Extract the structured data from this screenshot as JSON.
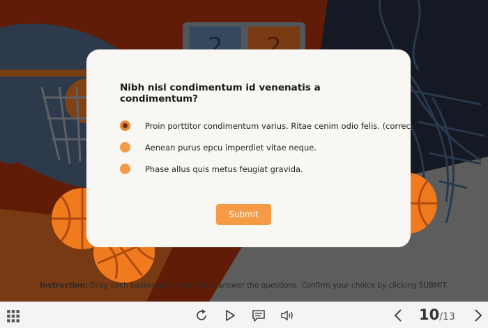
{
  "question": {
    "text": "Nibh nisl condimentum id venenatis a condimentum?",
    "options": [
      {
        "label": "Proin porttitor condimentum varius. Ritae cenim odio felis. (correct)",
        "selected": true
      },
      {
        "label": "Aenean purus epcu imperdiet vitae neque.",
        "selected": false
      },
      {
        "label": "Phase allus quis metus feugiat gravida.",
        "selected": false
      }
    ],
    "submit_label": "Submit"
  },
  "scoreboard": {
    "left": "2",
    "right": "2"
  },
  "instruction": {
    "prefix": "Instruction:",
    "text": " Drag each basketball to the net to answer the questions. Confirm your choice by clicking SUBMIT."
  },
  "navigation": {
    "current_page": "10",
    "total_pages": "/13",
    "icons": [
      "grid-menu-icon",
      "replay-icon",
      "play-icon",
      "comment-icon",
      "volume-icon",
      "prev-arrow-icon",
      "next-arrow-icon"
    ]
  },
  "colors": {
    "accent": "#f59a45",
    "background_dark": "#1c2333",
    "background_red": "#8e2a0b",
    "background_blue": "#3d4f66"
  }
}
